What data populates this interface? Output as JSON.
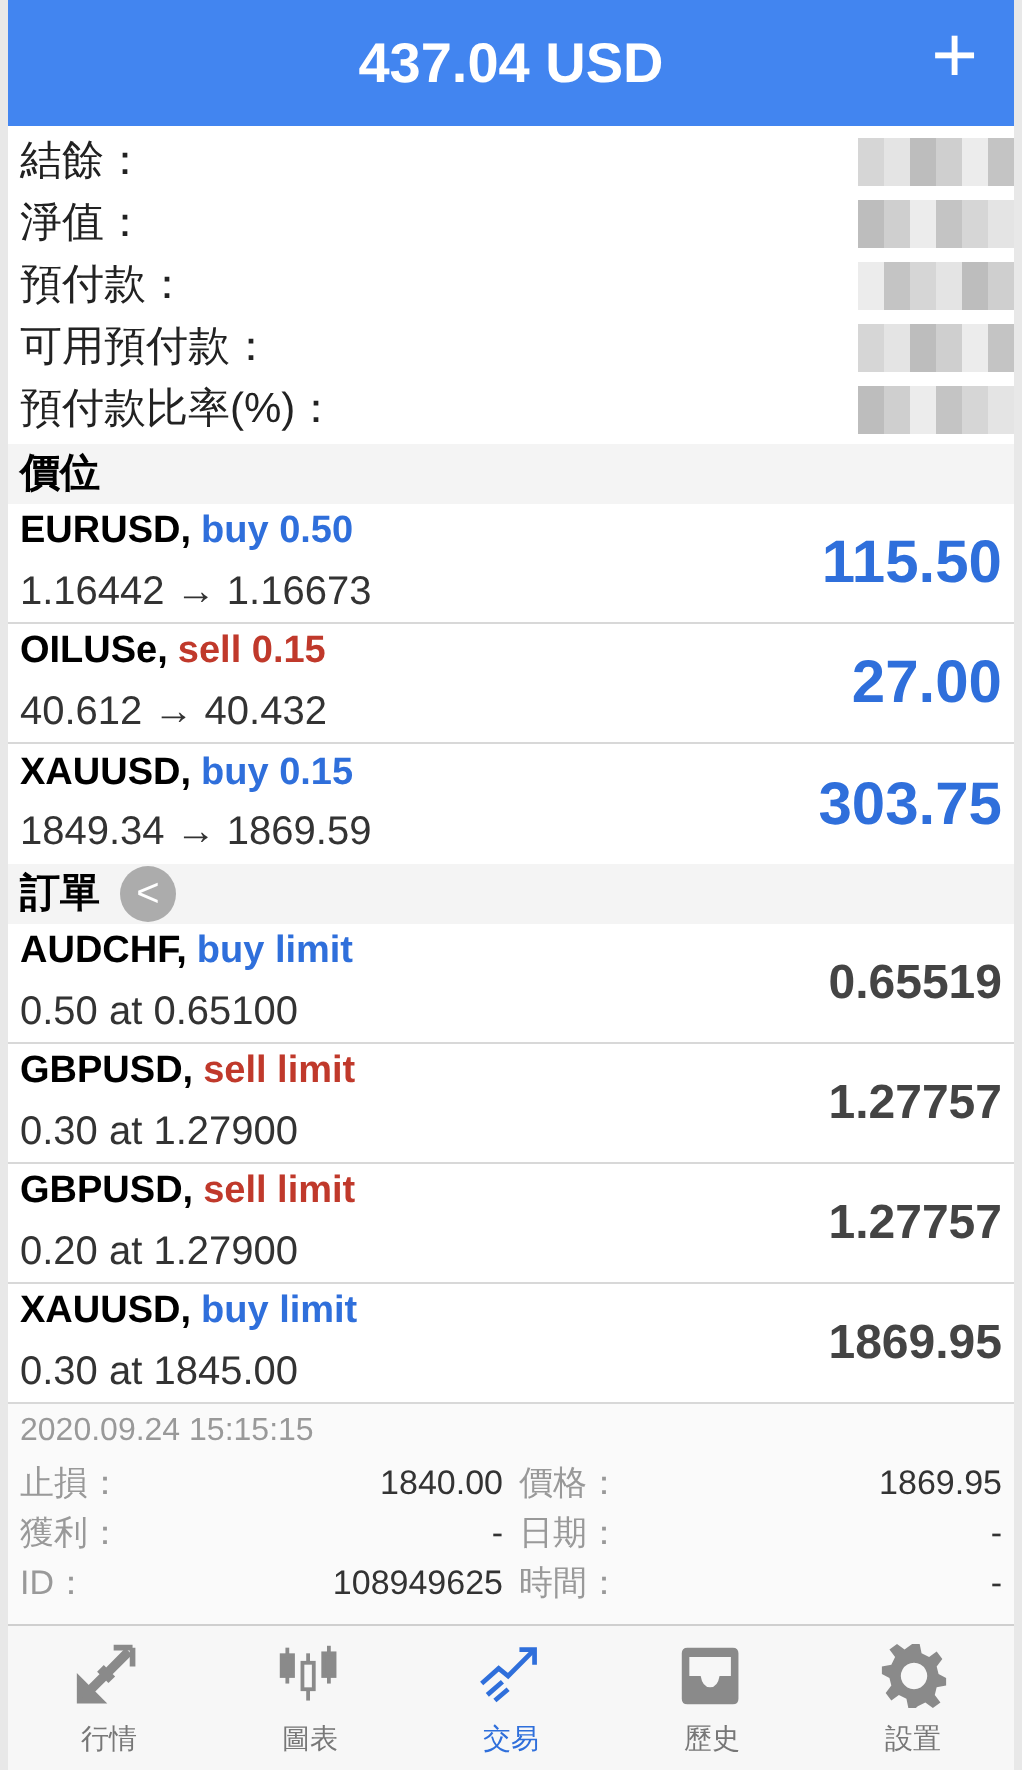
{
  "header": {
    "title": "437.04 USD",
    "add_button": "+"
  },
  "summary": [
    {
      "label": "結餘："
    },
    {
      "label": "淨值："
    },
    {
      "label": "預付款："
    },
    {
      "label": "可用預付款："
    },
    {
      "label": "預付款比率(%)："
    }
  ],
  "positions": {
    "title": "價位",
    "items": [
      {
        "symbol": "EURUSD,",
        "kind": "buy",
        "order": "buy 0.50",
        "prices": "1.16442 → 1.16673",
        "profit": "115.50"
      },
      {
        "symbol": "OILUSe,",
        "kind": "sell",
        "order": "sell 0.15",
        "prices": "40.612 → 40.432",
        "profit": "27.00"
      },
      {
        "symbol": "XAUUSD,",
        "kind": "buy",
        "order": "buy 0.15",
        "prices": "1849.34 → 1869.59",
        "profit": "303.75"
      }
    ]
  },
  "back_button": "<",
  "orders": {
    "title": "訂單",
    "items": [
      {
        "symbol": "AUDCHF,",
        "kind": "buy",
        "order": "buy limit",
        "detail": "0.50 at 0.65100",
        "price": "0.65519"
      },
      {
        "symbol": "GBPUSD,",
        "kind": "sell",
        "order": "sell limit",
        "detail": "0.30 at 1.27900",
        "price": "1.27757"
      },
      {
        "symbol": "GBPUSD,",
        "kind": "sell",
        "order": "sell limit",
        "detail": "0.20 at 1.27900",
        "price": "1.27757"
      },
      {
        "symbol": "XAUUSD,",
        "kind": "buy",
        "order": "buy limit",
        "detail": "0.30 at 1845.00",
        "price": "1869.95"
      }
    ]
  },
  "order_details": {
    "time": "2020.09.24 15:15:15",
    "rows": [
      [
        {
          "label": "止損：",
          "value": "1840.00"
        },
        {
          "label": "價格：",
          "value": "1869.95"
        }
      ],
      [
        {
          "label": "獲利：",
          "value": "-"
        },
        {
          "label": "日期：",
          "value": "-"
        }
      ],
      [
        {
          "label": "ID：",
          "value": "108949625"
        },
        {
          "label": "時間：",
          "value": "-"
        }
      ]
    ]
  },
  "tab_bar": [
    {
      "label": "行情",
      "selected": false
    },
    {
      "label": "圖表",
      "selected": false
    },
    {
      "label": "交易",
      "selected": true
    },
    {
      "label": "歷史",
      "selected": false
    },
    {
      "label": "設置",
      "selected": false
    }
  ]
}
